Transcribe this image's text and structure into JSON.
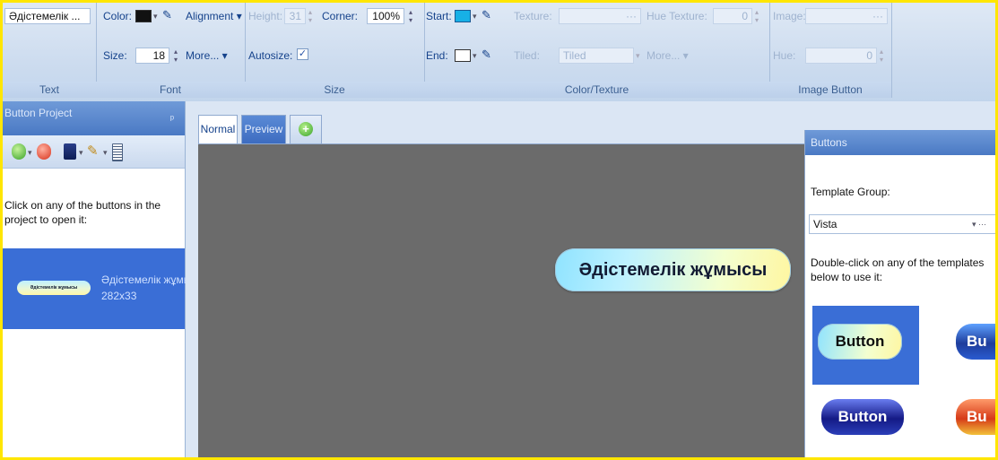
{
  "ribbon": {
    "text_group": {
      "font_name": "Әдістемелік ...",
      "label": "Text"
    },
    "font_group": {
      "color_label": "Color:",
      "size_label": "Size:",
      "size_value": "18",
      "alignment_label": "Alignment",
      "more_label": "More...",
      "label": "Font"
    },
    "size_group": {
      "height_label": "Height:",
      "height_value": "31",
      "corner_label": "Corner:",
      "corner_value": "100%",
      "autosize_label": "Autosize:",
      "autosize_checked": "✓",
      "label": "Size"
    },
    "color_group": {
      "start_label": "Start:",
      "end_label": "End:",
      "texture_label": "Texture:",
      "tiled_label": "Tiled:",
      "tiled_value": "Tiled",
      "hue_texture_label": "Hue Texture:",
      "hue_texture_value": "0",
      "more_label": "More...",
      "label": "Color/Texture",
      "ellipsis": "···"
    },
    "image_group": {
      "image_label": "Image:",
      "hue_label": "Hue:",
      "hue_value": "0",
      "label": "Image Button",
      "ellipsis": "···"
    },
    "colors": {
      "font_color": "#111111",
      "start_color": "#17b0e6",
      "end_color": "#ffffff"
    }
  },
  "left_panel": {
    "title": "Button Project",
    "pin": "ᵖ",
    "message": "Click on any of the buttons in the project to open it:",
    "item": {
      "thumb_text": "Әдістемелік жұмысы",
      "name": "Әдістемелік жұмысы",
      "size": "282x33"
    }
  },
  "editor": {
    "tabs": [
      {
        "label": "Normal"
      },
      {
        "label": "Preview"
      },
      {
        "label": "+"
      }
    ],
    "preview_button_text": "Әдістемелік жұмысы"
  },
  "buttons_panel": {
    "title": "Buttons",
    "template_group_label": "Template Group:",
    "template_group_value": "Vista",
    "select_arrows": "▾ ···",
    "message": "Double-click on any of the templates below to use it:",
    "templates": [
      {
        "label": "Button"
      },
      {
        "label": "Bu"
      },
      {
        "label": "Button"
      },
      {
        "label": "Bu"
      }
    ]
  }
}
